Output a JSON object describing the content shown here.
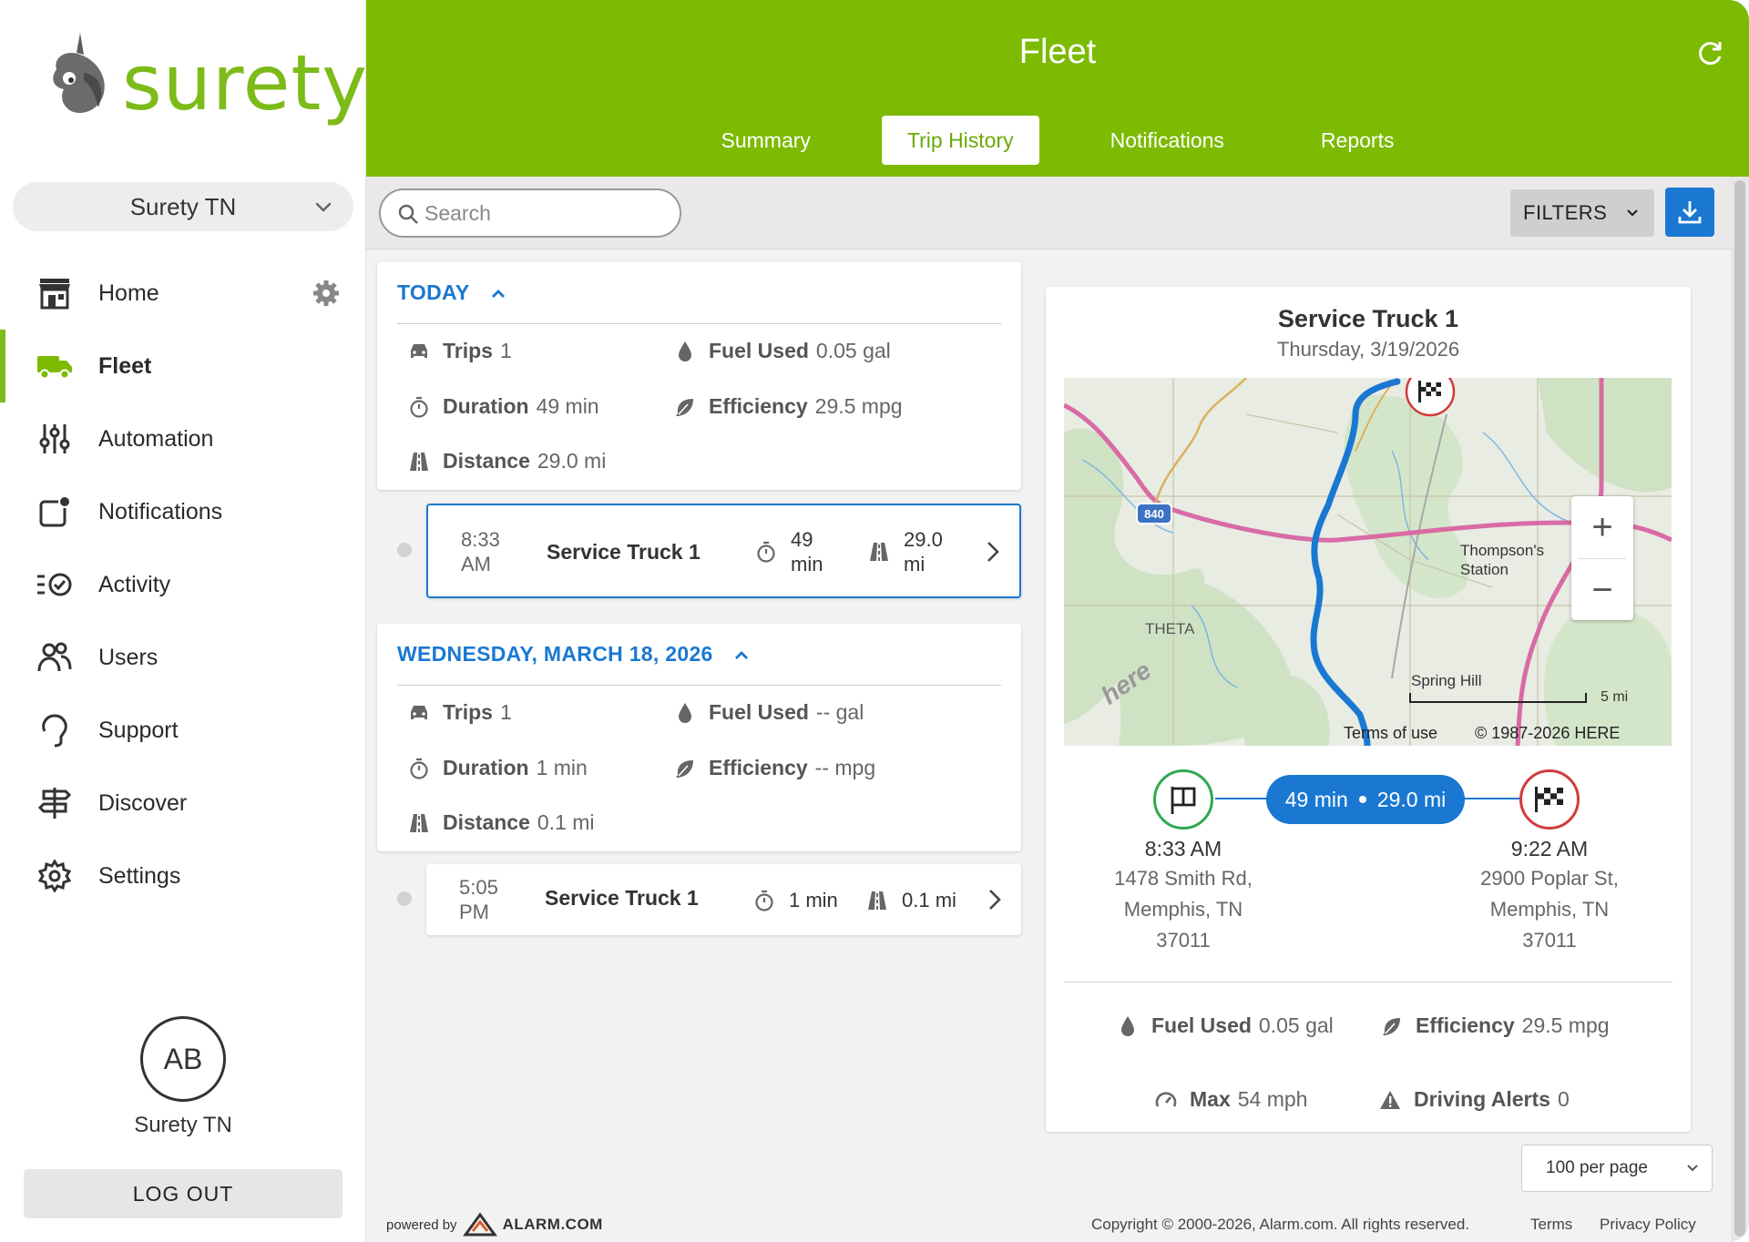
{
  "brand": {
    "name": "surety",
    "accent": "#7cbb02",
    "link_blue": "#1a78d2"
  },
  "sidebar": {
    "account": "Surety TN",
    "items": [
      {
        "label": "Home",
        "icon": "storefront-icon"
      },
      {
        "label": "Fleet",
        "icon": "truck-icon"
      },
      {
        "label": "Automation",
        "icon": "sliders-icon"
      },
      {
        "label": "Notifications",
        "icon": "notification-icon"
      },
      {
        "label": "Activity",
        "icon": "activity-icon"
      },
      {
        "label": "Users",
        "icon": "users-icon"
      },
      {
        "label": "Support",
        "icon": "headset-icon"
      },
      {
        "label": "Discover",
        "icon": "signpost-icon"
      },
      {
        "label": "Settings",
        "icon": "gear-icon"
      }
    ],
    "user_initials": "AB",
    "user_name": "Surety TN",
    "logout": "LOG OUT"
  },
  "header": {
    "title": "Fleet",
    "tabs": [
      "Summary",
      "Trip History",
      "Notifications",
      "Reports"
    ],
    "active_tab": "Trip History"
  },
  "toolbar": {
    "search_placeholder": "Search",
    "filters": "FILTERS"
  },
  "days": [
    {
      "heading": "TODAY",
      "stats": {
        "trips_label": "Trips",
        "trips": "1",
        "fuel_label": "Fuel Used",
        "fuel": "0.05 gal",
        "duration_label": "Duration",
        "duration": "49 min",
        "efficiency_label": "Efficiency",
        "efficiency": "29.5 mpg",
        "distance_label": "Distance",
        "distance": "29.0 mi"
      },
      "trip": {
        "time_1": "8:33",
        "time_2": "AM",
        "name": "Service Truck 1",
        "dur_1": "49",
        "dur_2": "min",
        "dist_1": "29.0",
        "dist_2": "mi"
      }
    },
    {
      "heading": "WEDNESDAY, MARCH 18, 2026",
      "stats": {
        "trips_label": "Trips",
        "trips": "1",
        "fuel_label": "Fuel Used",
        "fuel": "-- gal",
        "duration_label": "Duration",
        "duration": "1 min",
        "efficiency_label": "Efficiency",
        "efficiency": "-- mpg",
        "distance_label": "Distance",
        "distance": "0.1 mi"
      },
      "trip": {
        "time_1": "5:05",
        "time_2": "PM",
        "name": "Service Truck 1",
        "dur": "1 min",
        "dist": "0.1 mi"
      }
    }
  ],
  "detail": {
    "title": "Service Truck 1",
    "date": "Thursday, 3/19/2026",
    "map": {
      "labels": [
        "Thompson's",
        "Station",
        "THETA",
        "Spring Hill",
        "840",
        "here"
      ],
      "scale": "5 mi",
      "terms": "Terms of use",
      "copyright": "© 1987-2026 HERE"
    },
    "summary_duration": "49 min",
    "summary_distance": "29.0 mi",
    "start": {
      "time": "8:33 AM",
      "line1": "1478 Smith Rd,",
      "line2": "Memphis, TN",
      "line3": "37011"
    },
    "end": {
      "time": "9:22 AM",
      "line1": "2900 Poplar St,",
      "line2": "Memphis, TN",
      "line3": "37011"
    },
    "stats": {
      "fuel_label": "Fuel Used",
      "fuel": "0.05 gal",
      "efficiency_label": "Efficiency",
      "efficiency": "29.5 mpg",
      "max_label": "Max",
      "max": "54 mph",
      "alerts_label": "Driving Alerts",
      "alerts": "0"
    }
  },
  "footer": {
    "per_page": "100 per page",
    "powered_by": "powered by",
    "powered_brand": "ALARM.COM",
    "copyright": "Copyright © 2000-2026, Alarm.com. All rights reserved.",
    "terms": "Terms",
    "privacy": "Privacy Policy"
  }
}
